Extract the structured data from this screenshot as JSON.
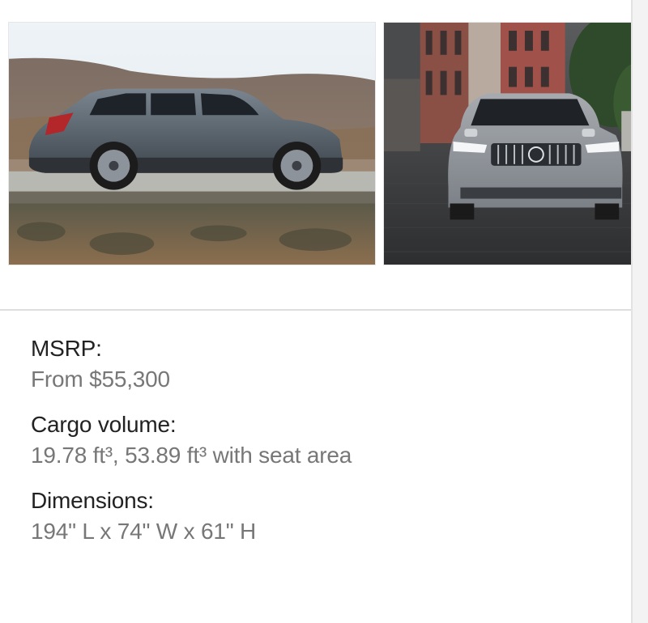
{
  "gallery": {
    "images": [
      {
        "alt": "side-view-wagon-photo"
      },
      {
        "alt": "front-view-wagon-photo"
      }
    ]
  },
  "specs": [
    {
      "label": "MSRP:",
      "value": "From $55,300"
    },
    {
      "label": "Cargo volume:",
      "value": "19.78 ft³, 53.89 ft³ with seat area"
    },
    {
      "label": "Dimensions:",
      "value": "194\" L x 74\" W x 61\" H"
    }
  ],
  "colors": {
    "label": "#222222",
    "value": "#777777",
    "divider": "#dedede"
  }
}
